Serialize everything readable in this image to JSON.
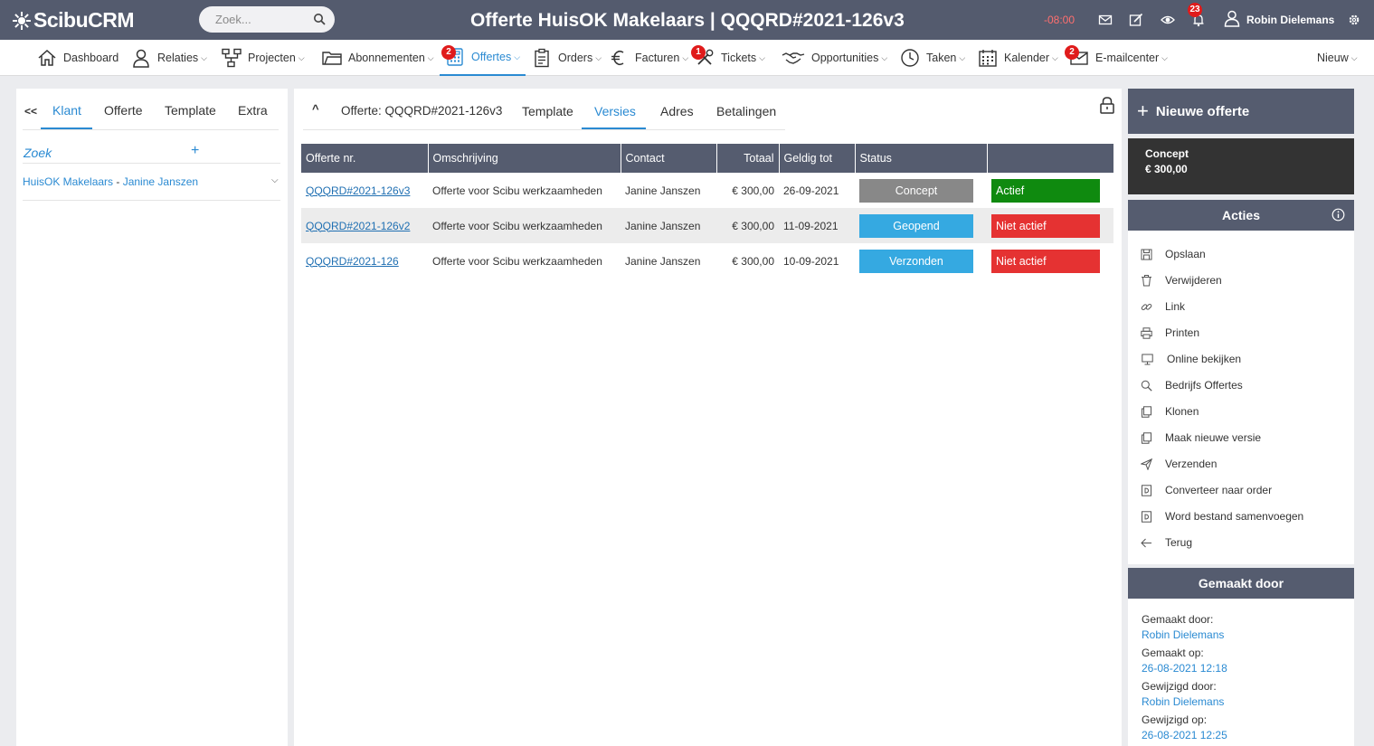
{
  "topbar": {
    "logo": "ScibuCRM",
    "search_placeholder": "Zoek...",
    "title": "Offerte HuisOK Makelaars | QQQRD#2021-126v3",
    "timer": "-08:00",
    "notification_count": "23",
    "user_name": "Robin Dielemans"
  },
  "nav": {
    "items": [
      {
        "label": "Dashboard",
        "icon": "home-icon"
      },
      {
        "label": "Relaties",
        "icon": "user-icon"
      },
      {
        "label": "Projecten",
        "icon": "project-icon"
      },
      {
        "label": "Abonnementen",
        "icon": "folder-icon"
      },
      {
        "label": "Offertes",
        "icon": "calculator-icon",
        "badge": "2"
      },
      {
        "label": "Orders",
        "icon": "clipboard-icon"
      },
      {
        "label": "Facturen",
        "icon": "euro-icon"
      },
      {
        "label": "Tickets",
        "icon": "tools-icon",
        "badge": "1"
      },
      {
        "label": "Opportunities",
        "icon": "handshake-icon"
      },
      {
        "label": "Taken",
        "icon": "clock-icon"
      },
      {
        "label": "Kalender",
        "icon": "calendar-icon"
      },
      {
        "label": "E-mailcenter",
        "icon": "mail-icon",
        "badge": "2"
      }
    ],
    "new_label": "Nieuw"
  },
  "left": {
    "back": "<<",
    "tabs": [
      "Klant",
      "Offerte",
      "Template",
      "Extra"
    ],
    "search_label": "Zoek",
    "plus": "+",
    "relation_company": "HuisOK Makelaars",
    "relation_sep": " - ",
    "relation_contact": "Janine Janszen"
  },
  "center": {
    "collapse": "^",
    "tabs": [
      "Offerte: QQQRD#2021-126v3",
      "Template",
      "Versies",
      "Adres",
      "Betalingen"
    ],
    "table": {
      "headers": [
        "Offerte nr.",
        "Omschrijving",
        "Contact",
        "Totaal",
        "Geldig tot",
        "Status",
        ""
      ],
      "rows": [
        {
          "nr": "QQQRD#2021-126v3",
          "desc": "Offerte voor Scibu werkzaamheden",
          "contact": "Janine Janszen",
          "total": "€ 300,00",
          "valid": "26-09-2021",
          "status": "Concept",
          "active": "Actief"
        },
        {
          "nr": "QQQRD#2021-126v2",
          "desc": "Offerte voor Scibu werkzaamheden",
          "contact": "Janine Janszen",
          "total": "€ 300,00",
          "valid": "11-09-2021",
          "status": "Geopend",
          "active": "Niet actief"
        },
        {
          "nr": "QQQRD#2021-126",
          "desc": "Offerte voor Scibu werkzaamheden",
          "contact": "Janine Janszen",
          "total": "€ 300,00",
          "valid": "10-09-2021",
          "status": "Verzonden",
          "active": "Niet actief"
        }
      ]
    }
  },
  "right": {
    "new_quote": "Nieuwe offerte",
    "concept_label": "Concept",
    "concept_amount": "€ 300,00",
    "actions_title": "Acties",
    "actions": [
      {
        "label": "Opslaan",
        "icon": "save-icon"
      },
      {
        "label": "Verwijderen",
        "icon": "trash-icon"
      },
      {
        "label": "Link",
        "icon": "link-icon"
      },
      {
        "label": "Printen",
        "icon": "print-icon"
      },
      {
        "label": "Online bekijken",
        "icon": "monitor-icon"
      },
      {
        "label": "Bedrijfs Offertes",
        "icon": "search-icon"
      },
      {
        "label": "Klonen",
        "icon": "copy-icon"
      },
      {
        "label": "Maak nieuwe versie",
        "icon": "copy-icon"
      },
      {
        "label": "Verzenden",
        "icon": "send-icon"
      },
      {
        "label": "Converteer naar order",
        "icon": "document-icon"
      },
      {
        "label": "Word bestand samenvoegen",
        "icon": "document-icon"
      },
      {
        "label": "Terug",
        "icon": "arrow-left-icon"
      }
    ],
    "made_by_title": "Gemaakt door",
    "created_by_label": "Gemaakt door:",
    "created_by": "Robin Dielemans",
    "created_on_label": "Gemaakt op:",
    "created_on": "26-08-2021 12:18",
    "modified_by_label": "Gewijzigd door:",
    "modified_by": "Robin Dielemans",
    "modified_on_label": "Gewijzigd op:",
    "modified_on": "26-08-2021 12:25"
  },
  "colors": {
    "topbar": "#545b6e",
    "accent": "#2a8ad2",
    "status_concept": "#888888",
    "status_blue": "#35a9e1",
    "active_green": "#0f8a0f",
    "inactive_red": "#e53232",
    "badge_red": "#e01b1b"
  }
}
